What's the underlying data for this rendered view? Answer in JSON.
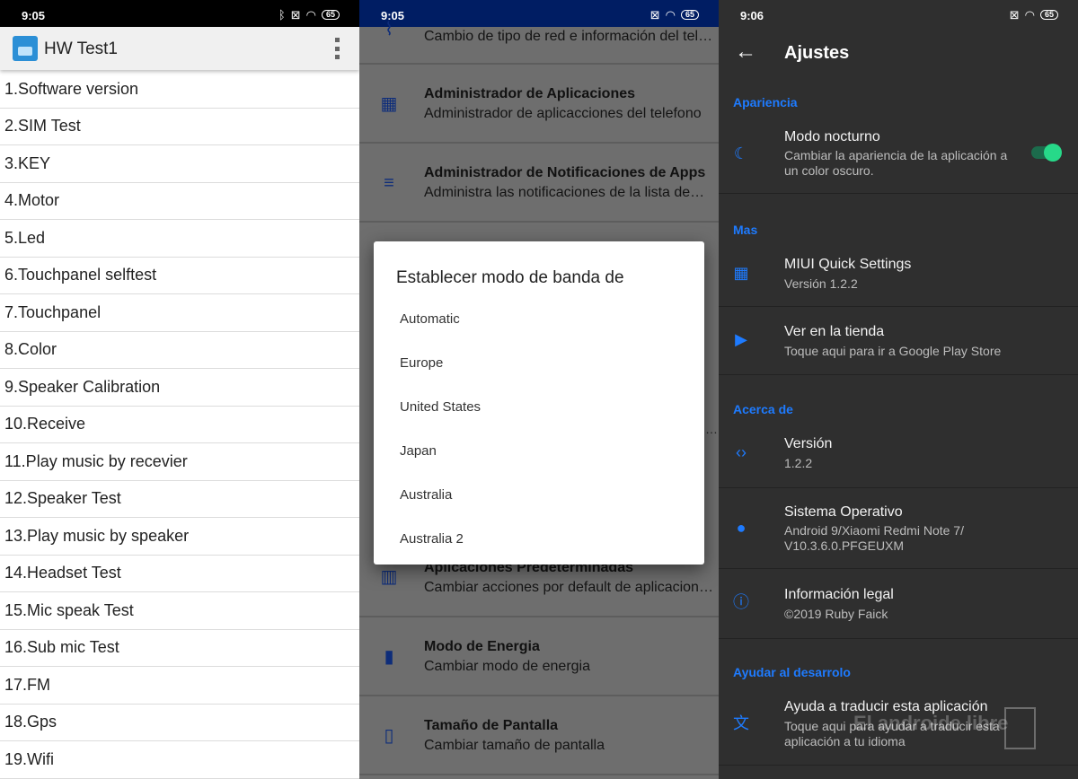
{
  "status": {
    "p1_time": "9:05",
    "p2_time": "9:05",
    "p3_time": "9:06",
    "battery": "65"
  },
  "hwtest": {
    "title": "HW Test1",
    "items": [
      "1.Software version",
      "2.SIM Test",
      "3.KEY",
      "4.Motor",
      "5.Led",
      "6.Touchpanel selftest",
      "7.Touchpanel",
      "8.Color",
      "9.Speaker Calibration",
      "10.Receive",
      "11.Play music by recevier",
      "12.Speaker Test",
      "13.Play music by speaker",
      "14.Headset Test",
      "15.Mic speak Test",
      "16.Sub mic Test",
      "17.FM",
      "18.Gps",
      "19.Wifi"
    ]
  },
  "background_list": {
    "rows": [
      {
        "title": "",
        "sub": "Cambio de tipo de red e información del tel…"
      },
      {
        "title": "Administrador de Aplicaciones",
        "sub": "Administrador de aplicacciones del telefono"
      },
      {
        "title": "Administrador de Notificaciones de Apps",
        "sub": "Administra las notificaciones de la lista de…"
      },
      {
        "title": "Aplicaciones Predeterminadas",
        "sub": "Cambiar acciones por default de aplicacion…"
      },
      {
        "title": "Modo de Energia",
        "sub": "Cambiar modo de energia"
      },
      {
        "title": "Tamaño de Pantalla",
        "sub": "Cambiar tamaño de pantalla"
      }
    ],
    "truncated_marker": "…"
  },
  "dialog": {
    "title": "Establecer modo de banda de",
    "options": [
      "Automatic",
      "Europe",
      "United States",
      "Japan",
      "Australia",
      "Australia 2"
    ]
  },
  "settings": {
    "title": "Ajustes",
    "sections": {
      "apariencia": "Apariencia",
      "mas": "Mas",
      "acerca": "Acerca de",
      "ayudar": "Ayudar al desarrolo"
    },
    "night_mode": {
      "title": "Modo nocturno",
      "sub": "Cambiar la apariencia de la aplicación a un color oscuro.",
      "enabled": true
    },
    "quick_settings": {
      "title": "MIUI Quick Settings",
      "sub": "Versión 1.2.2"
    },
    "store": {
      "title": "Ver en la tienda",
      "sub": "Toque aqui para ir a Google Play Store"
    },
    "version": {
      "title": "Versión",
      "sub": "1.2.2"
    },
    "os": {
      "title": "Sistema Operativo",
      "sub": "Android 9/Xiaomi Redmi Note 7/ V10.3.6.0.PFGEUXM"
    },
    "legal": {
      "title": "Información legal",
      "sub": "©2019 Ruby Faick"
    },
    "translate": {
      "title": "Ayuda a traducir esta aplicación",
      "sub": "Toque aqui para ayudar a traducir esta aplicación a tu idioma"
    },
    "accent_color": "#1e7bff",
    "toggle_color": "#27d989"
  },
  "watermark": "El androide libre"
}
